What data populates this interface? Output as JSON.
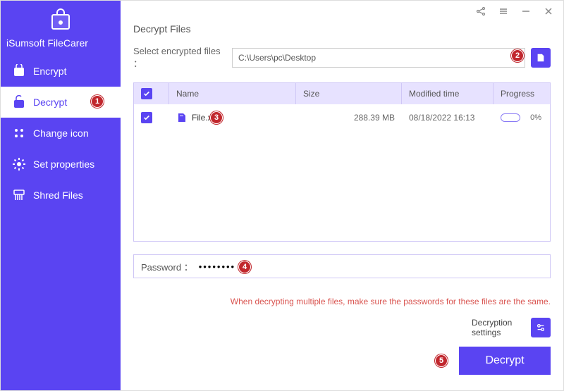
{
  "brand": {
    "name": "iSumsoft FileCarer"
  },
  "sidebar": {
    "items": [
      {
        "label": "Encrypt",
        "icon": "lock-icon"
      },
      {
        "label": "Decrypt",
        "icon": "unlock-icon",
        "active": true
      },
      {
        "label": "Change icon",
        "icon": "grid-icon"
      },
      {
        "label": "Set properties",
        "icon": "gear-icon"
      },
      {
        "label": "Shred Files",
        "icon": "shred-icon"
      }
    ]
  },
  "window": {
    "share": "share",
    "menu": "menu",
    "minimize": "—",
    "close": "×"
  },
  "main": {
    "title": "Decrypt Files",
    "path_label": "Select encrypted files ：",
    "path_value": "C:\\Users\\pc\\Desktop",
    "columns": {
      "name": "Name",
      "size": "Size",
      "mtime": "Modified time",
      "progress": "Progress"
    },
    "rows": [
      {
        "name": "File.xep",
        "size": "288.39 MB",
        "mtime": "08/18/2022 16:13",
        "pct": "0%"
      }
    ],
    "pwd_label": "Password ：",
    "pwd_value": "••••••••",
    "warning": "When decrypting multiple files, make sure the passwords for these files are the same.",
    "dec_settings_label": "Decryption settings",
    "decrypt_btn": "Decrypt"
  },
  "callouts": {
    "c1": "1",
    "c2": "2",
    "c3": "3",
    "c4": "4",
    "c5": "5"
  }
}
